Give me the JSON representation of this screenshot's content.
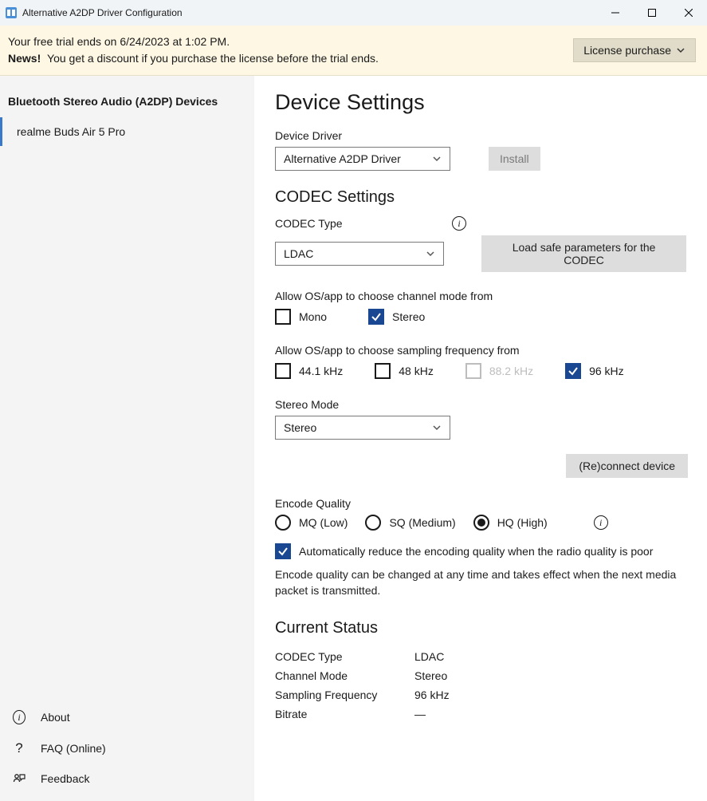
{
  "window": {
    "title": "Alternative A2DP Driver Configuration"
  },
  "notice": {
    "line1": "Your free trial ends on 6/24/2023 at 1:02 PM.",
    "bold": "News!",
    "line2": "You get a discount if you purchase the license before the trial ends.",
    "button": "License purchase"
  },
  "sidebar": {
    "heading": "Bluetooth Stereo Audio (A2DP) Devices",
    "device": "realme Buds Air 5 Pro",
    "footer": {
      "about": "About",
      "faq": "FAQ (Online)",
      "feedback": "Feedback"
    }
  },
  "content": {
    "title": "Device Settings",
    "driver": {
      "label": "Device Driver",
      "value": "Alternative A2DP Driver",
      "install": "Install"
    },
    "codec": {
      "heading": "CODEC Settings",
      "typeLabel": "CODEC Type",
      "typeValue": "LDAC",
      "loadSafe": "Load safe parameters for the CODEC",
      "channelLabel": "Allow OS/app to choose channel mode from",
      "mono": "Mono",
      "stereo": "Stereo",
      "freqLabel": "Allow OS/app to choose sampling frequency from",
      "f44": "44.1 kHz",
      "f48": "48 kHz",
      "f88": "88.2 kHz",
      "f96": "96 kHz",
      "stereoModeLabel": "Stereo Mode",
      "stereoModeValue": "Stereo",
      "reconnect": "(Re)connect device"
    },
    "encode": {
      "label": "Encode Quality",
      "mq": "MQ (Low)",
      "sq": "SQ (Medium)",
      "hq": "HQ (High)",
      "auto": "Automatically reduce the encoding quality when the radio quality is poor",
      "note": "Encode quality can be changed at any time and takes effect when the next media packet is transmitted."
    },
    "status": {
      "heading": "Current Status",
      "codecLabel": "CODEC Type",
      "codecValue": "LDAC",
      "channelLabel": "Channel Mode",
      "channelValue": "Stereo",
      "freqLabel": "Sampling Frequency",
      "freqValue": "96 kHz",
      "bitrateLabel": "Bitrate",
      "bitrateValue": "—"
    }
  }
}
